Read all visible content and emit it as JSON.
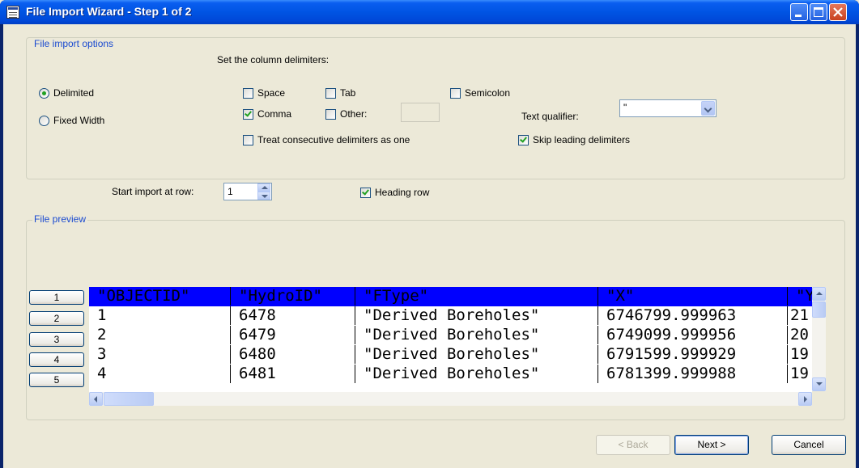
{
  "window": {
    "title": "File Import Wizard - Step 1 of 2"
  },
  "options": {
    "group_title": "File import options",
    "delimiters_heading": "Set the column delimiters:",
    "radio_delimited": "Delimited",
    "radio_fixed_width": "Fixed Width",
    "space": "Space",
    "tab": "Tab",
    "semicolon": "Semicolon",
    "comma": "Comma",
    "other": "Other:",
    "other_value": "",
    "text_qualifier_label": "Text qualifier:",
    "text_qualifier_value": "\"",
    "treat_consecutive": "Treat consecutive delimiters as one",
    "skip_leading": "Skip leading delimiters"
  },
  "start": {
    "label": "Start import at row:",
    "value": "1",
    "heading_row": "Heading row"
  },
  "preview": {
    "group_title": "File preview",
    "row_numbers": [
      "1",
      "2",
      "3",
      "4",
      "5"
    ],
    "header": [
      "\"OBJECTID\"",
      "\"HydroID\"",
      "\"FType\"",
      "\"X\"",
      "\"Y\""
    ],
    "rows": [
      [
        "1",
        "6478",
        "\"Derived Boreholes\"",
        "6746799.999963",
        "21"
      ],
      [
        "2",
        "6479",
        "\"Derived Boreholes\"",
        "6749099.999956",
        "20"
      ],
      [
        "3",
        "6480",
        "\"Derived Boreholes\"",
        "6791599.999929",
        "19"
      ],
      [
        "4",
        "6481",
        "\"Derived Boreholes\"",
        "6781399.999988",
        "19"
      ]
    ]
  },
  "buttons": {
    "back": "< Back",
    "next": "Next >",
    "cancel": "Cancel"
  },
  "colors": {
    "titlebar": "#0054e3",
    "group_title": "#1a4ad0",
    "preview_header": "#0000ff",
    "check_green": "#21a121"
  }
}
